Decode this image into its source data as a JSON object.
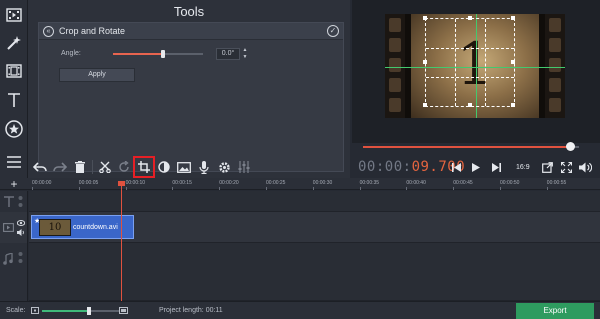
{
  "sidebar": {
    "items": [
      {
        "name": "import",
        "icon": "film-import-icon"
      },
      {
        "name": "filters",
        "icon": "magic-wand-icon"
      },
      {
        "name": "transitions",
        "icon": "transitions-icon"
      },
      {
        "name": "titles",
        "icon": "text-t-icon"
      },
      {
        "name": "stickers",
        "icon": "star-badge-icon"
      },
      {
        "name": "more",
        "icon": "menu-lines-icon"
      }
    ]
  },
  "tools": {
    "title": "Tools",
    "section_title": "Crop and Rotate",
    "angle_label": "Angle:",
    "angle_value": "0.0°",
    "angle_slider_fraction": 0.55,
    "apply_label": "Apply"
  },
  "preview": {
    "countdown_number": "1",
    "playback_fraction": 0.96
  },
  "toolbar": {
    "buttons": [
      "undo-icon",
      "redo-icon",
      "delete-icon",
      "cut-icon",
      "rotate-icon",
      "crop-icon",
      "color-adjust-icon",
      "image-icon",
      "microphone-icon",
      "gear-icon",
      "equalizer-icon"
    ]
  },
  "transport": {
    "timecode_prefix": "00:00:",
    "timecode_value": "09.700",
    "aspect_ratio": "16:9"
  },
  "ruler": {
    "labels": [
      "00:00:00",
      "00:00:05",
      "00:00:10",
      "00:00:15",
      "00:00:20",
      "00:00:25",
      "00:00:30",
      "00:00:35",
      "00:00:40",
      "00:00:45",
      "00:00:50",
      "00:00:55"
    ]
  },
  "timeline": {
    "clip_name": "countdown.avi",
    "clip_thumb_text": "10"
  },
  "footer": {
    "scale_label": "Scale:",
    "zoom_fraction": 0.6,
    "project_length_label": "Project length:",
    "project_length_value": "00:11",
    "export_label": "Export"
  },
  "colors": {
    "accent_red": "#e0523f",
    "export_green": "#2e9b5f",
    "clip_blue": "#3a66c9",
    "guide_green": "#43c96e"
  }
}
